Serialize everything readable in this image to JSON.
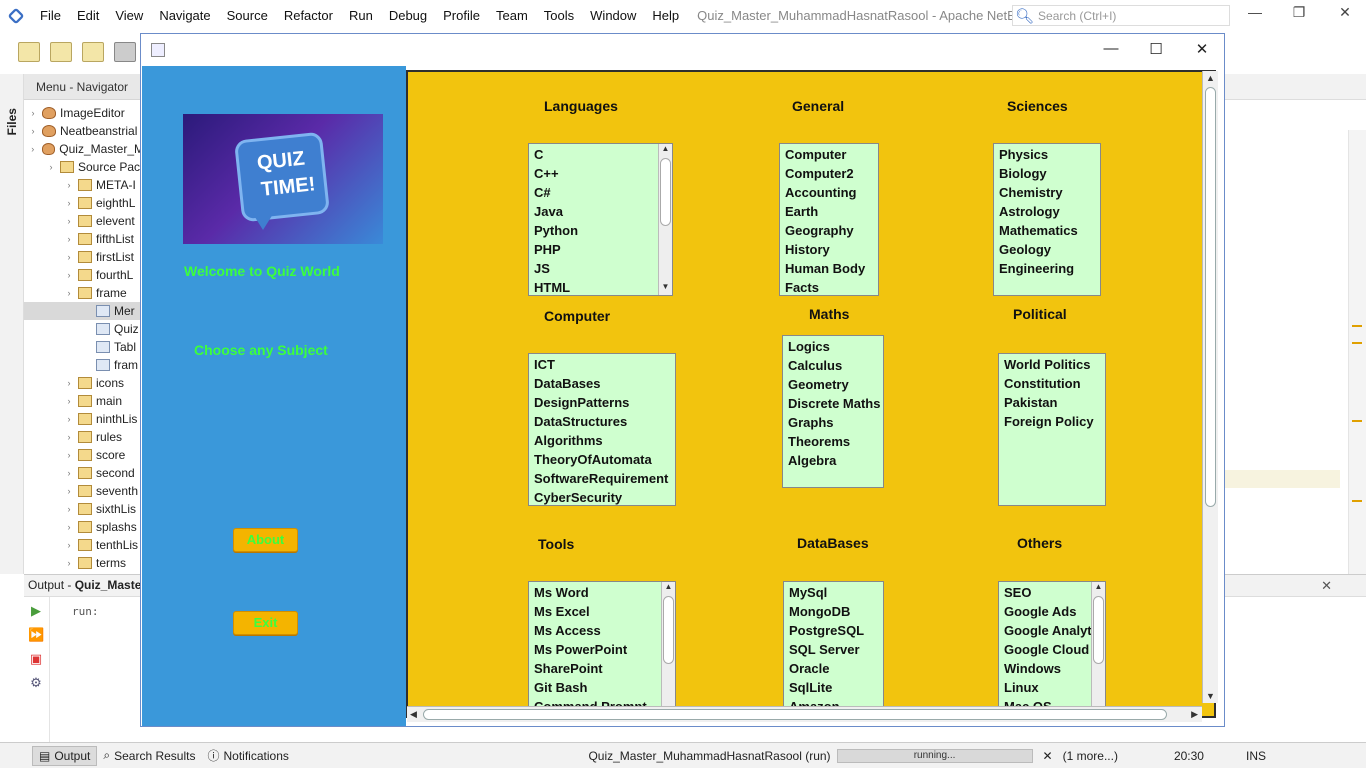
{
  "ide": {
    "menu": [
      "File",
      "Edit",
      "View",
      "Navigate",
      "Source",
      "Refactor",
      "Run",
      "Debug",
      "Profile",
      "Team",
      "Tools",
      "Window",
      "Help"
    ],
    "title": "Quiz_Master_MuhammadHasnatRasool - Apache NetBeans ID...",
    "search_placeholder": "Search (Ctrl+I)"
  },
  "navigator": {
    "header": "Menu - Navigator",
    "files_tab": "Files",
    "tree": [
      {
        "label": "ImageEditor",
        "icon": "coffee-cup-icon",
        "indent": 0
      },
      {
        "label": "Neatbeanstrial",
        "icon": "coffee-cup-icon",
        "indent": 0
      },
      {
        "label": "Quiz_Master_M",
        "icon": "coffee-cup-icon",
        "indent": 0
      },
      {
        "label": "Source Pac",
        "icon": "folder-icon",
        "indent": 1
      },
      {
        "label": "META-I",
        "icon": "package-icon",
        "indent": 2
      },
      {
        "label": "eighthL",
        "icon": "package-icon",
        "indent": 2
      },
      {
        "label": "elevent",
        "icon": "package-icon",
        "indent": 2
      },
      {
        "label": "fifthList",
        "icon": "package-icon",
        "indent": 2
      },
      {
        "label": "firstList",
        "icon": "package-icon",
        "indent": 2
      },
      {
        "label": "fourthL",
        "icon": "package-icon",
        "indent": 2
      },
      {
        "label": "frame",
        "icon": "package-icon",
        "indent": 2
      },
      {
        "label": "Mer",
        "icon": "form-icon",
        "indent": 3,
        "selected": true
      },
      {
        "label": "Quiz",
        "icon": "form-icon",
        "indent": 3
      },
      {
        "label": "Tabl",
        "icon": "form-icon",
        "indent": 3
      },
      {
        "label": "fram",
        "icon": "form-icon",
        "indent": 3
      },
      {
        "label": "icons",
        "icon": "package-icon",
        "indent": 2
      },
      {
        "label": "main",
        "icon": "package-icon",
        "indent": 2
      },
      {
        "label": "ninthLis",
        "icon": "package-icon",
        "indent": 2
      },
      {
        "label": "rules",
        "icon": "package-icon",
        "indent": 2
      },
      {
        "label": "score",
        "icon": "package-icon",
        "indent": 2
      },
      {
        "label": "second",
        "icon": "package-icon",
        "indent": 2
      },
      {
        "label": "seventh",
        "icon": "package-icon",
        "indent": 2
      },
      {
        "label": "sixthLis",
        "icon": "package-icon",
        "indent": 2
      },
      {
        "label": "splashs",
        "icon": "package-icon",
        "indent": 2
      },
      {
        "label": "tenthLis",
        "icon": "package-icon",
        "indent": 2
      },
      {
        "label": "terms",
        "icon": "package-icon",
        "indent": 2
      }
    ]
  },
  "output": {
    "header_prefix": "Output - ",
    "header_bold": "Quiz_Maste",
    "text": "run:"
  },
  "status_bar": {
    "tabs": [
      "Output",
      "Search Results",
      "Notifications"
    ],
    "run_label": "Quiz_Master_MuhammadHasnatRasool (run)",
    "progress_text": "running...",
    "more": "(1 more...)",
    "position": "20:30",
    "mode": "INS"
  },
  "app": {
    "banner_line1": "QUIZ",
    "banner_line2": "TIME!",
    "welcome": "Welcome to Quiz World",
    "choose": "Choose any Subject",
    "about_button": "About",
    "exit_button": "Exit",
    "categories": [
      {
        "title": "Languages",
        "items": [
          "C",
          "C++",
          "C#",
          "Java",
          "Python",
          "PHP",
          "JS",
          "HTML"
        ],
        "scroll": true
      },
      {
        "title": "General",
        "items": [
          "Computer",
          "Computer2",
          "Accounting",
          "Earth",
          "Geography",
          "History",
          "Human Body",
          "Facts"
        ],
        "scroll": false
      },
      {
        "title": "Sciences",
        "items": [
          "Physics",
          "Biology",
          "Chemistry",
          "Astrology",
          "Mathematics",
          "Geology",
          "Engineering"
        ],
        "scroll": false
      },
      {
        "title": "Computer",
        "items": [
          "ICT",
          "DataBases",
          "DesignPatterns",
          "DataStructures",
          "Algorithms",
          "TheoryOfAutomata",
          "SoftwareRequirement",
          "CyberSecurity"
        ],
        "scroll": false
      },
      {
        "title": "Maths",
        "items": [
          "Logics",
          "Calculus",
          "Geometry",
          "Discrete Maths",
          "Graphs",
          "Theorems",
          "Algebra"
        ],
        "scroll": false
      },
      {
        "title": "Political",
        "items": [
          "World Politics",
          "Constitution",
          "Pakistan",
          "Foreign Policy"
        ],
        "scroll": false
      },
      {
        "title": "Tools",
        "items": [
          "Ms Word",
          "Ms Excel",
          "Ms Access",
          "Ms PowerPoint",
          "SharePoint",
          "Git Bash",
          "Command Prompt"
        ],
        "scroll": true
      },
      {
        "title": "DataBases",
        "items": [
          "MySql",
          "MongoDB",
          "PostgreSQL",
          "SQL Server",
          "Oracle",
          "SqlLite",
          "Amazon"
        ],
        "scroll": false
      },
      {
        "title": "Others",
        "items": [
          "SEO",
          "Google Ads",
          "Google Analytics",
          "Google Cloud Platform",
          "Windows",
          "Linux",
          "Mac OS"
        ],
        "scroll": true
      }
    ]
  },
  "colors": {
    "sidebar": "#3a98da",
    "content_bg": "#f2c40e",
    "list_bg": "#cfffcf",
    "label_green": "#3cff3c",
    "button_bg": "#f4b400"
  }
}
